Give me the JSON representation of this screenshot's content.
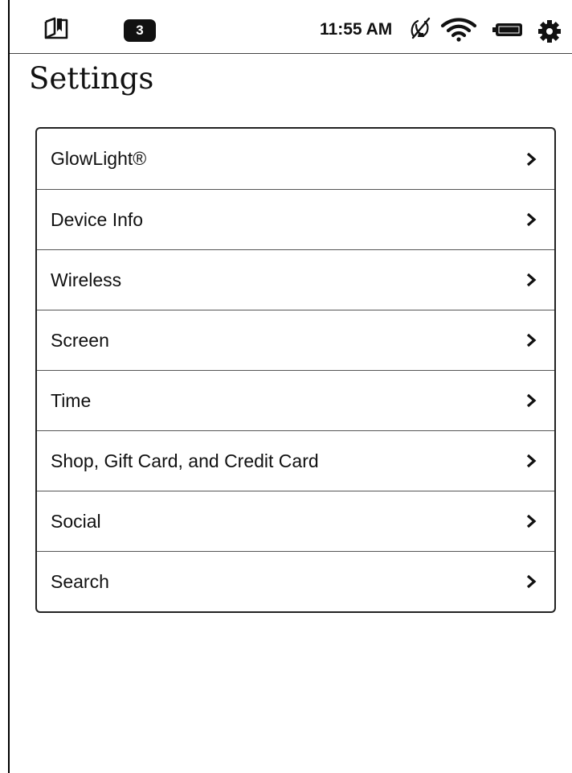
{
  "status_bar": {
    "notification_count": "3",
    "time": "11:55 AM",
    "icons": [
      "book-icon",
      "sync-off-icon",
      "wifi-icon",
      "battery-icon",
      "gear-icon"
    ]
  },
  "page": {
    "title": "Settings"
  },
  "settings": {
    "items": [
      {
        "label": "GlowLight®"
      },
      {
        "label": "Device Info"
      },
      {
        "label": "Wireless"
      },
      {
        "label": "Screen"
      },
      {
        "label": "Time"
      },
      {
        "label": "Shop, Gift Card, and Credit Card"
      },
      {
        "label": "Social"
      },
      {
        "label": "Search"
      }
    ]
  }
}
